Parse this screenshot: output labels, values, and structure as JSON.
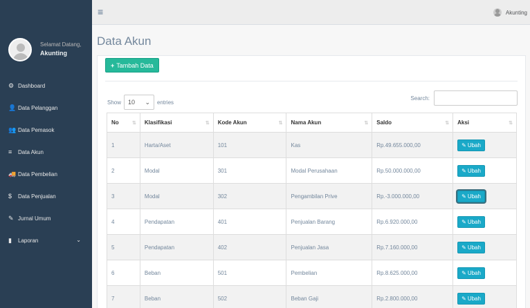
{
  "sidebar": {
    "welcome": "Selamat Datang,",
    "username": "Akunting",
    "items": [
      {
        "label": "Dashboard",
        "icon": "dashboard-icon",
        "glyph": "⚙"
      },
      {
        "label": "Data Pelanggan",
        "icon": "user-icon",
        "glyph": "👤"
      },
      {
        "label": "Data Pemasok",
        "icon": "users-icon",
        "glyph": "👥"
      },
      {
        "label": "Data Akun",
        "icon": "list-icon",
        "glyph": "≡"
      },
      {
        "label": "Data Pembelian",
        "icon": "truck-icon",
        "glyph": "🚚"
      },
      {
        "label": "Data Penjualan",
        "icon": "dollar-icon",
        "glyph": "$"
      },
      {
        "label": "Jurnal Umum",
        "icon": "edit-icon",
        "glyph": "✎"
      },
      {
        "label": "Laporan",
        "icon": "file-icon",
        "glyph": "▮"
      }
    ]
  },
  "topnav": {
    "user": "Akunting"
  },
  "main": {
    "title": "Data Akun",
    "add_button": "Tambah Data",
    "show_label": "Show",
    "entries_value": "10",
    "entries_label": "entries",
    "search_label": "Search:",
    "search_value": ""
  },
  "table": {
    "headers": [
      "No",
      "Klasifikasi",
      "Kode Akun",
      "Nama Akun",
      "Saldo",
      "Aksi"
    ],
    "rows": [
      [
        "1",
        "Harta/Aset",
        "101",
        "Kas",
        "Rp.49.655.000,00"
      ],
      [
        "2",
        "Modal",
        "301",
        "Modal Perusahaan",
        "Rp.50.000.000,00"
      ],
      [
        "3",
        "Modal",
        "302",
        "Pengambilan Prive",
        "Rp.-3.000.000,00"
      ],
      [
        "4",
        "Pendapatan",
        "401",
        "Penjualan Barang",
        "Rp.6.920.000,00"
      ],
      [
        "5",
        "Pendapatan",
        "402",
        "Penjualan Jasa",
        "Rp.7.160.000,00"
      ],
      [
        "6",
        "Beban",
        "501",
        "Pembelian",
        "Rp.8.625.000,00"
      ],
      [
        "7",
        "Beban",
        "502",
        "Beban Gaji",
        "Rp.2.800.000,00"
      ]
    ],
    "action_label": "Ubah"
  },
  "colors": {
    "sidebar": "#2a3f54",
    "add_button": "#26b99a",
    "edit_button": "#1aa9c8"
  }
}
